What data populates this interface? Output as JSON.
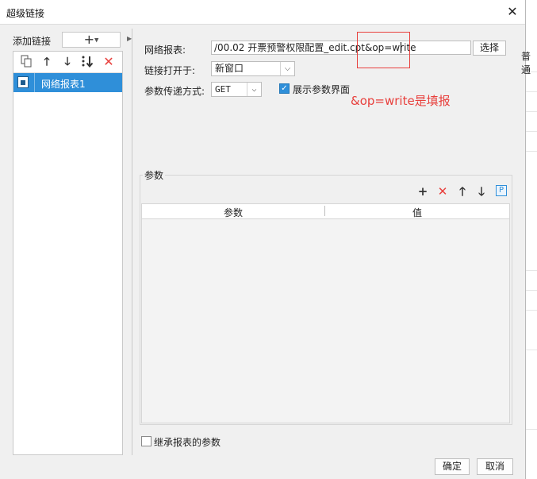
{
  "window": {
    "title": "超级链接",
    "close_glyph": "✕"
  },
  "background": {
    "partial_text": "普通"
  },
  "left": {
    "add_label": "添加链接",
    "add_button_glyph": "+",
    "toolbar_icons": [
      "copy-icon",
      "move-up-icon",
      "move-down-icon",
      "sort-icon",
      "delete-icon"
    ],
    "tree": [
      {
        "label": "网络报表1",
        "selected": true
      }
    ]
  },
  "form": {
    "report_label": "网络报表:",
    "report_url": "/00.02 开票预警权限配置_edit.cpt&op=write",
    "choose_button": "选择",
    "open_label": "链接打开于:",
    "open_value": "新窗口",
    "method_label": "参数传递方式:",
    "method_value": "GET",
    "show_params_label": "展示参数界面",
    "show_params_checked": true
  },
  "annotation": {
    "text": "&op=write是填报",
    "color": "#e8403d"
  },
  "params": {
    "title": "参数",
    "toolbar_icons": [
      "add-icon",
      "delete-icon",
      "move-up-icon",
      "move-down-icon",
      "parameter-icon"
    ],
    "p_icon_text": "P",
    "columns": [
      "参数",
      "值"
    ],
    "rows": []
  },
  "inherit": {
    "label": "继承报表的参数",
    "checked": false
  },
  "buttons": {
    "ok": "确定",
    "cancel": "取消"
  },
  "colors": {
    "selection": "#2f8fd9",
    "accent_red": "#e8403d"
  }
}
